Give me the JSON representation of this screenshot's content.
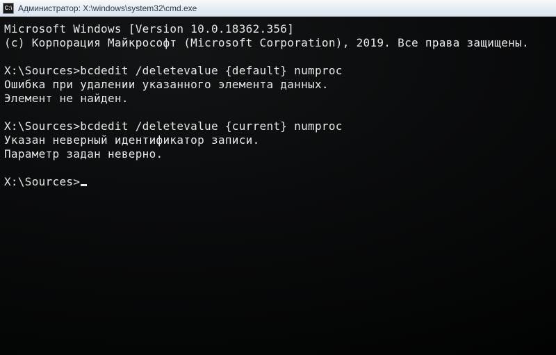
{
  "titlebar": {
    "icon_label": "C:\\",
    "text": "Администратор: X:\\windows\\system32\\cmd.exe"
  },
  "terminal": {
    "lines": [
      "Microsoft Windows [Version 10.0.18362.356]",
      "(c) Корпорация Майкрософт (Microsoft Corporation), 2019. Все права защищены.",
      "",
      "X:\\Sources>bcdedit /deletevalue {default} numproc",
      "Ошибка при удалении указанного элемента данных.",
      "Элемент не найден.",
      "",
      "X:\\Sources>bcdedit /deletevalue {current} numproc",
      "Указан неверный идентификатор записи.",
      "Параметр задан неверно.",
      "",
      "X:\\Sources>"
    ],
    "cursor_on_last": true
  }
}
